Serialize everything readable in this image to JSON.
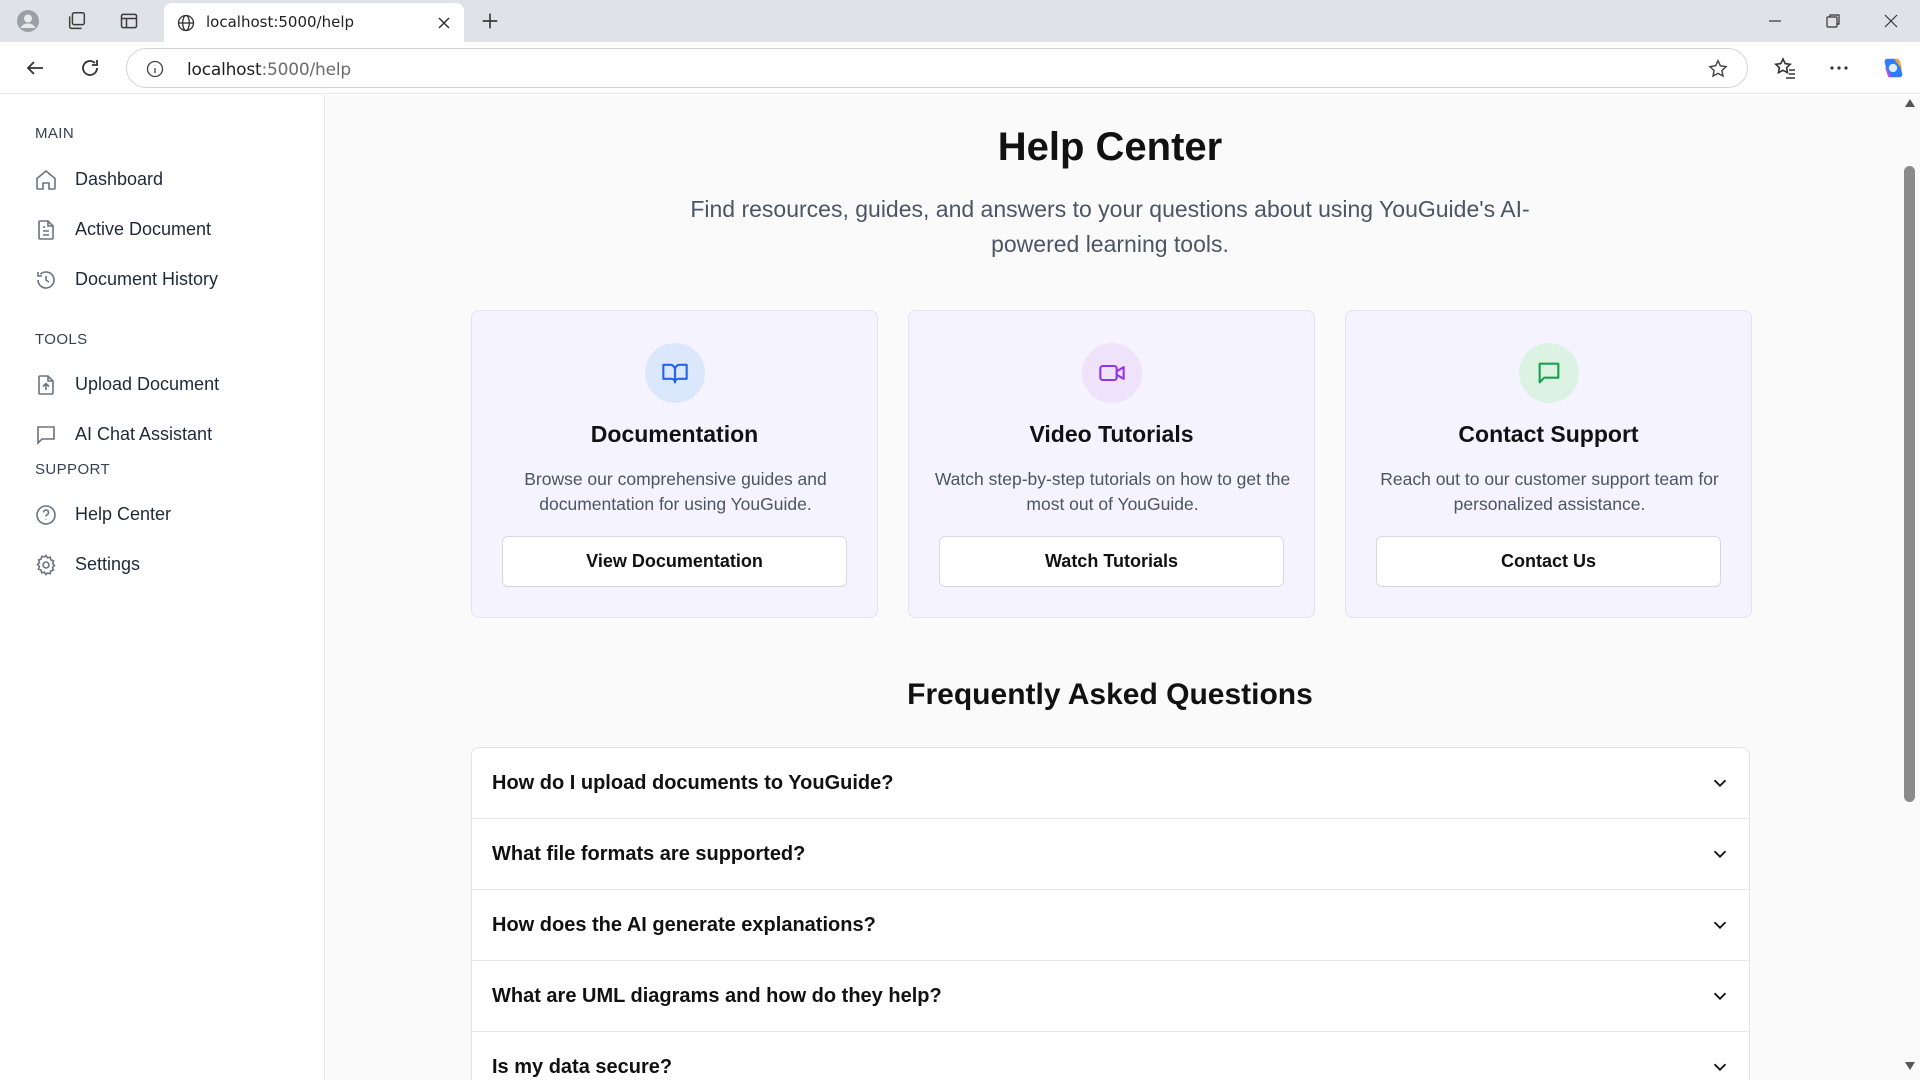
{
  "browser": {
    "tab_title": "localhost:5000/help",
    "url_host": "localhost",
    "url_rest": ":5000/help"
  },
  "sidebar": {
    "sections": [
      {
        "title": "MAIN",
        "items": [
          {
            "label": "Dashboard",
            "icon": "home-icon"
          },
          {
            "label": "Active Document",
            "icon": "document-icon"
          },
          {
            "label": "Document History",
            "icon": "history-icon"
          }
        ]
      },
      {
        "title": "TOOLS",
        "items": [
          {
            "label": "Upload Document",
            "icon": "upload-file-icon"
          },
          {
            "label": "AI Chat Assistant",
            "icon": "chat-icon"
          }
        ]
      },
      {
        "title": "SUPPORT",
        "items": [
          {
            "label": "Help Center",
            "icon": "help-circle-icon"
          },
          {
            "label": "Settings",
            "icon": "gear-icon"
          }
        ]
      }
    ]
  },
  "main": {
    "title": "Help Center",
    "subtitle": "Find resources, guides, and answers to your questions about using YouGuide's AI-powered learning tools.",
    "cards": [
      {
        "title": "Documentation",
        "description": "Browse our comprehensive guides and documentation for using YouGuide.",
        "button": "View Documentation",
        "icon": "book-open-icon",
        "icon_color": "#2563eb",
        "icon_bg": "#dbe7fb"
      },
      {
        "title": "Video Tutorials",
        "description": "Watch step-by-step tutorials on how to get the most out of YouGuide.",
        "button": "Watch Tutorials",
        "icon": "video-icon",
        "icon_color": "#9333ea",
        "icon_bg": "#efe3fb"
      },
      {
        "title": "Contact Support",
        "description": "Reach out to our customer support team for personalized assistance.",
        "button": "Contact Us",
        "icon": "message-square-icon",
        "icon_color": "#16a34a",
        "icon_bg": "#dcf3e3"
      }
    ],
    "faq_title": "Frequently Asked Questions",
    "faq": [
      "How do I upload documents to YouGuide?",
      "What file formats are supported?",
      "How does the AI generate explanations?",
      "What are UML diagrams and how do they help?",
      "Is my data secure?"
    ]
  }
}
